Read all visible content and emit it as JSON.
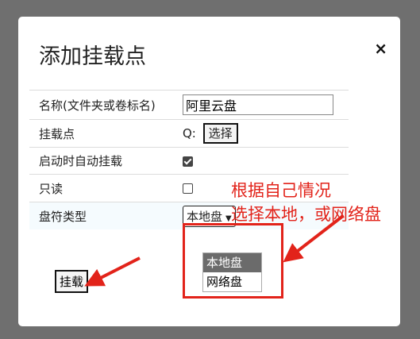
{
  "dialog": {
    "title": "添加挂载点",
    "close_glyph": "×"
  },
  "form": {
    "name_label": "名称(文件夹或卷标名)",
    "name_value": "阿里云盘",
    "mountpoint_label": "挂载点",
    "mountpoint_value": "Q:",
    "pick_button": "选择",
    "autostart_label": "启动时自动挂载",
    "autostart_checked": true,
    "readonly_label": "只读",
    "readonly_checked": false,
    "drive_type_label": "盘符类型",
    "drive_type_selected": "本地盘",
    "drive_type_options": [
      "本地盘",
      "网络盘"
    ]
  },
  "mount_button": "挂载",
  "annotation": {
    "line1": "根据自己情况",
    "line2": "选择本地，或网络盘",
    "color": "#e2231a"
  }
}
